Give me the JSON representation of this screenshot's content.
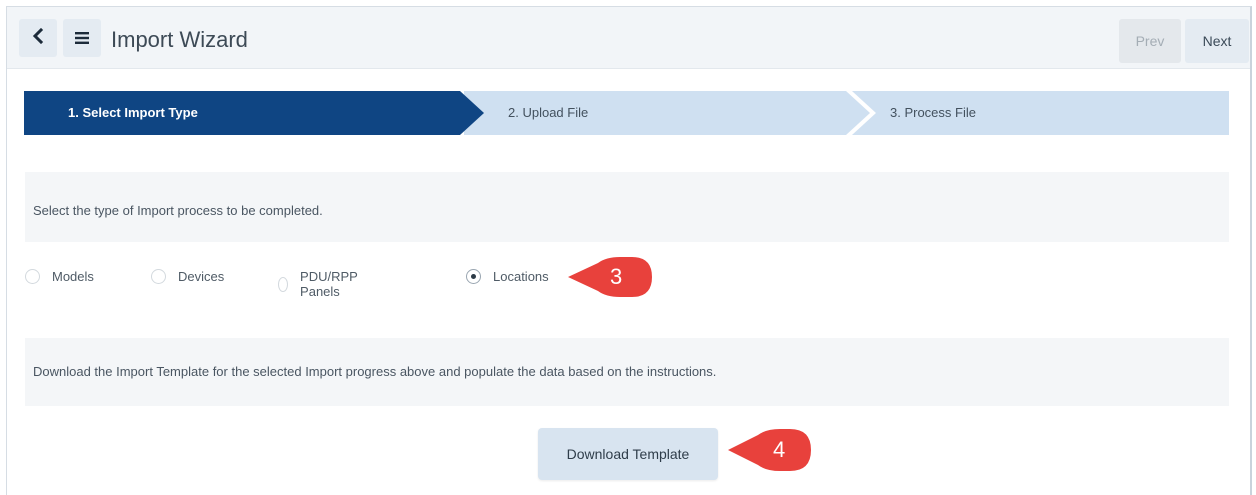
{
  "header": {
    "title": "Import Wizard",
    "prev_label": "Prev",
    "next_label": "Next"
  },
  "steps": [
    {
      "label": "1. Select Import Type",
      "active": true
    },
    {
      "label": "2. Upload File",
      "active": false
    },
    {
      "label": "3. Process File",
      "active": false
    }
  ],
  "instructions": {
    "select_type": "Select the type of Import process to be completed.",
    "download_hint": "Download the Import Template for the selected Import progress above and populate the data based on the instructions."
  },
  "import_types": [
    {
      "label": "Models",
      "checked": false
    },
    {
      "label": "Devices",
      "checked": false
    },
    {
      "label": "PDU/RPP Panels",
      "checked": false
    },
    {
      "label": "Locations",
      "checked": true
    }
  ],
  "download_button_label": "Download Template",
  "callouts": {
    "first": "3",
    "second": "4"
  },
  "colors": {
    "active_step": "#0f4583",
    "inactive_step": "#cfe0f1",
    "callout": "#e8413c",
    "topbar": "#f2f5f8"
  }
}
